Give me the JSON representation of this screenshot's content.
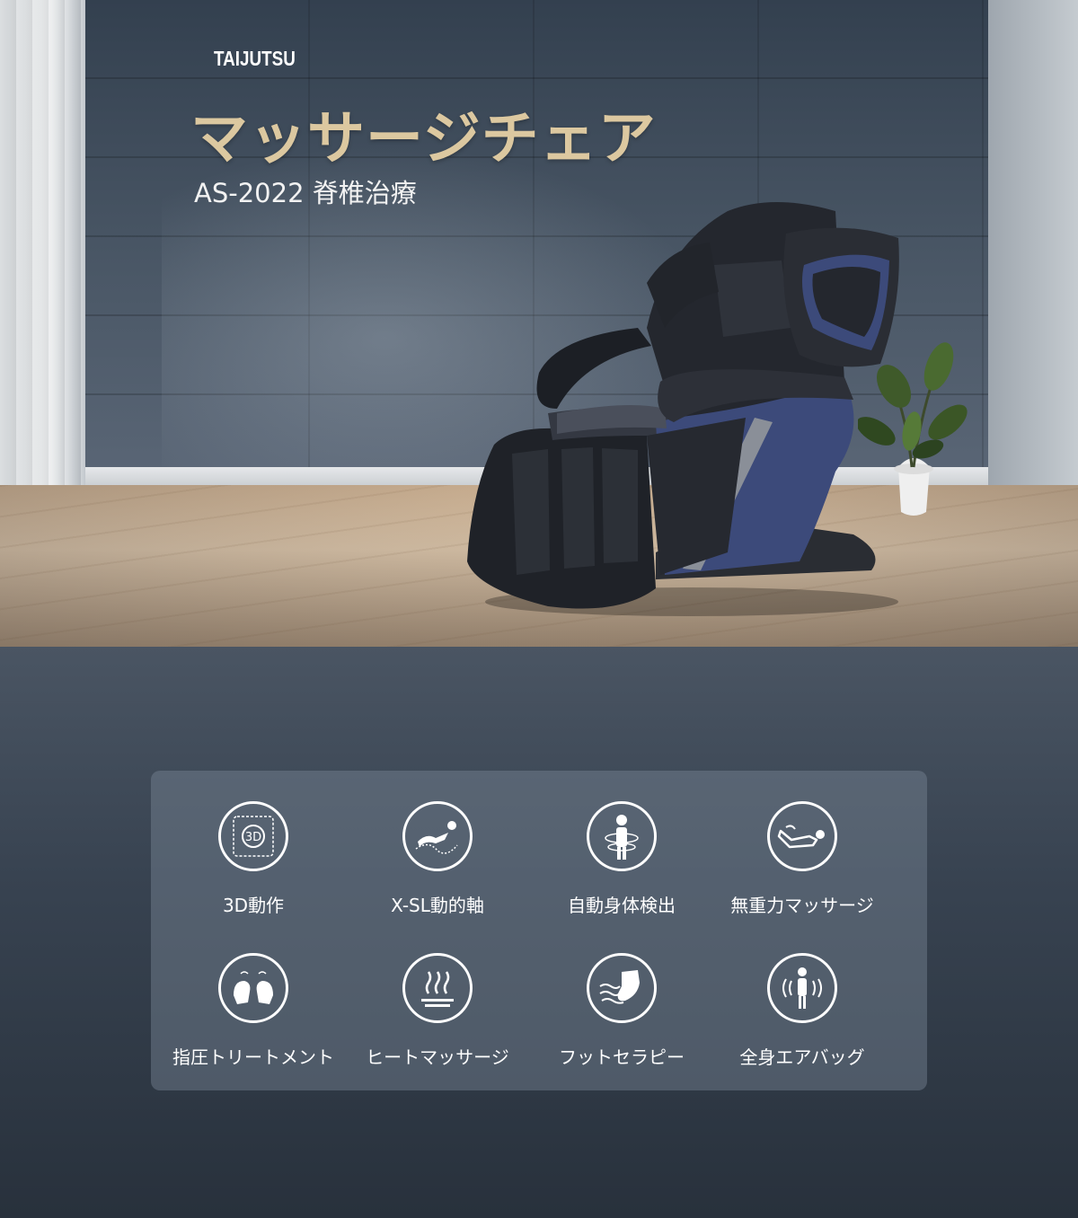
{
  "hero": {
    "brand": "TAIJUTSU",
    "title": "マッサージチェア",
    "subtitle": "AS-2022 脊椎治療"
  },
  "features": [
    {
      "label": "3D動作",
      "icon": "3d-motion-icon"
    },
    {
      "label": "X-SL動的軸",
      "icon": "recline-track-icon"
    },
    {
      "label": "自動身体検出",
      "icon": "body-scan-icon"
    },
    {
      "label": "無重力マッサージ",
      "icon": "zero-gravity-icon"
    },
    {
      "label": "指圧トリートメント",
      "icon": "shiatsu-hands-icon"
    },
    {
      "label": "ヒートマッサージ",
      "icon": "heat-icon"
    },
    {
      "label": "フットセラピー",
      "icon": "foot-therapy-icon"
    },
    {
      "label": "全身エアバッグ",
      "icon": "airbag-body-icon"
    }
  ],
  "colors": {
    "title_gold": "#dcc8a0",
    "chair_blue": "#3c4a7a",
    "panel_bg": "#5f6b78"
  }
}
